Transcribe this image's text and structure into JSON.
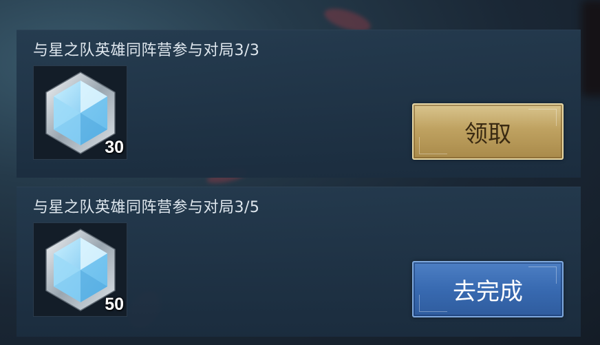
{
  "tasks": [
    {
      "title": "与星之队英雄同阵营参与对局3/3",
      "reward": {
        "icon": "crystal-icon",
        "count": "30"
      },
      "button": {
        "label": "领取",
        "style": "gold",
        "color": "#bfa261"
      }
    },
    {
      "title": "与星之队英雄同阵营参与对局3/5",
      "reward": {
        "icon": "crystal-icon",
        "count": "50"
      },
      "button": {
        "label": "去完成",
        "style": "blue",
        "color": "#386ab1"
      }
    }
  ]
}
